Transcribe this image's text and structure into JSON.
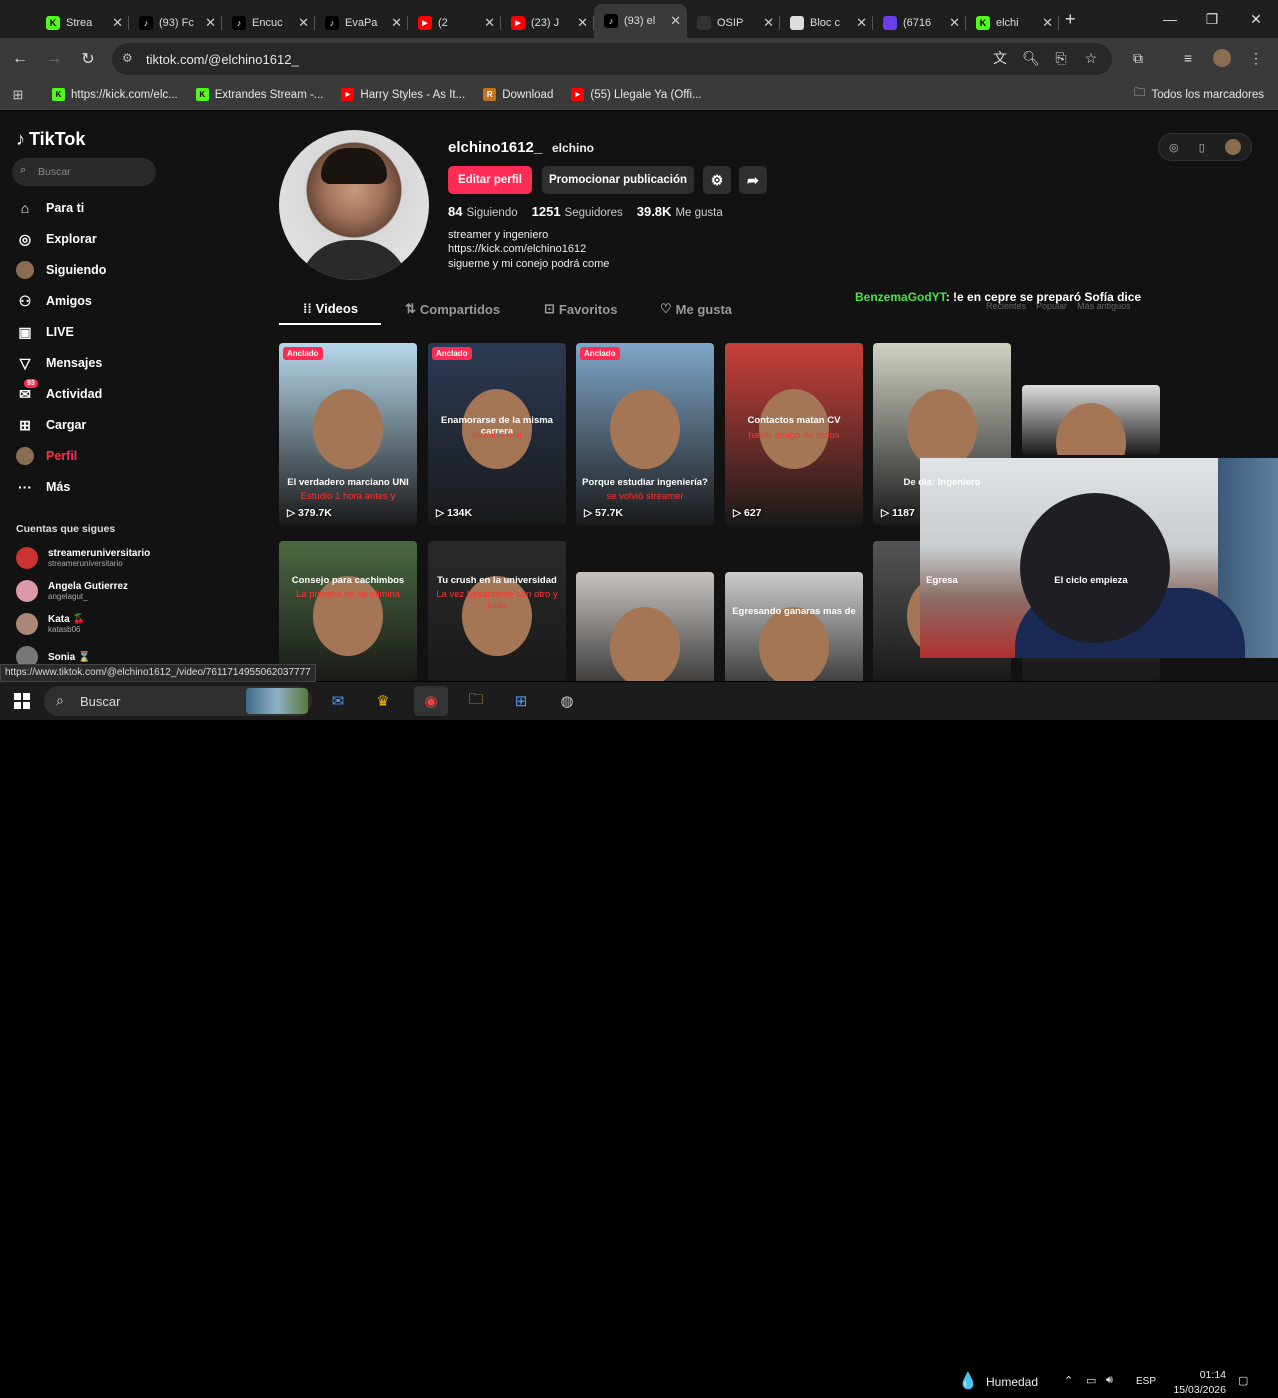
{
  "browser": {
    "tabs": [
      {
        "title": "Strea",
        "icon": "kick-icon",
        "color": "#53fc18"
      },
      {
        "title": "(93) Fc",
        "icon": "tiktok-icon",
        "color": "#000000"
      },
      {
        "title": "Encuc",
        "icon": "tiktok-icon",
        "color": "#000000"
      },
      {
        "title": "EvaPa",
        "icon": "tiktok-icon",
        "color": "#000000"
      },
      {
        "title": "(2",
        "icon": "youtube-icon",
        "color": "#ff0000"
      },
      {
        "title": "(23) J",
        "icon": "youtube-icon",
        "color": "#ff0000"
      },
      {
        "title": "(93) el",
        "icon": "tiktok-icon",
        "color": "#000000",
        "active": true
      },
      {
        "title": "OSIP",
        "icon": "openai-icon",
        "color": "#333333"
      },
      {
        "title": "Bloc c",
        "icon": "notepad-icon",
        "color": "#dddddd"
      },
      {
        "title": "(6716",
        "icon": "mail-icon",
        "color": "#6a3de8"
      },
      {
        "title": "elchi",
        "icon": "kick-icon",
        "color": "#53fc18"
      }
    ],
    "url": "tiktok.com/@elchino1612_",
    "bookmarks": [
      {
        "label": "https://kick.com/elc...",
        "icon": "kick-icon",
        "color": "#53fc18"
      },
      {
        "label": "Extrandes Stream -...",
        "icon": "kick-icon",
        "color": "#53fc18"
      },
      {
        "label": "Harry Styles - As It...",
        "icon": "youtube-icon",
        "color": "#ff0000"
      },
      {
        "label": "Download",
        "icon": "rbx-icon",
        "color": "#c0741b"
      },
      {
        "label": "(55) Llegale Ya (Offi...",
        "icon": "youtube-icon",
        "color": "#ff0000"
      }
    ],
    "all_bookmarks": "Todos los marcadores",
    "status_url": "https://www.tiktok.com/@elchino1612_/video/7611714955062037777"
  },
  "sidebar": {
    "logo": "TikTok",
    "search_placeholder": "Buscar",
    "items": [
      {
        "label": "Para ti",
        "icon": "home-icon"
      },
      {
        "label": "Explorar",
        "icon": "compass-icon"
      },
      {
        "label": "Siguiendo",
        "icon": "following-avatar-icon"
      },
      {
        "label": "Amigos",
        "icon": "friends-icon"
      },
      {
        "label": "LIVE",
        "icon": "live-icon"
      },
      {
        "label": "Mensajes",
        "icon": "send-icon"
      },
      {
        "label": "Actividad",
        "icon": "inbox-icon",
        "badge": "93"
      },
      {
        "label": "Cargar",
        "icon": "upload-icon"
      },
      {
        "label": "Perfil",
        "icon": "profile-avatar-icon",
        "active": true
      },
      {
        "label": "Más",
        "icon": "more-icon"
      }
    ],
    "follows_heading": "Cuentas que sigues",
    "follows": [
      {
        "name": "streameruniversitario",
        "handle": "streameruniversitario"
      },
      {
        "name": "Angela Gutierrez",
        "handle": "angelagut_"
      },
      {
        "name": "Kata 🍒",
        "handle": "katasb06"
      },
      {
        "name": "Sonia ⌛",
        "handle": ""
      }
    ]
  },
  "profile": {
    "username": "elchino1612_",
    "display_name": "elchino",
    "edit_button": "Editar perfil",
    "promote_button": "Promocionar publicación",
    "following_count": "84",
    "following_label": "Siguiendo",
    "followers_count": "1251",
    "followers_label": "Seguidores",
    "likes_count": "39.8K",
    "likes_label": "Me gusta",
    "bio": [
      "streamer y ingeniero",
      "https://kick.com/elchino1612",
      "sigueme y mi conejo podrá come"
    ],
    "tabs": [
      "Videos",
      "Compartidos",
      "Favoritos",
      "Me gusta"
    ],
    "sort": [
      "Recientes",
      "Popular",
      "Más antiguos"
    ],
    "overlay_chat": {
      "user": "BenzemaGodYT",
      "text": ": !e en cepre se preparó Sofía dice"
    }
  },
  "videos": [
    {
      "pinned": "Anclado",
      "views": "379.7K",
      "cap1": "El verdadero marciano UNI",
      "cap2": "Estudio 1 hora antes y"
    },
    {
      "pinned": "Anclado",
      "views": "134K",
      "cap1": "Enamorarse de la misma carrera",
      "cap2": "termina mal"
    },
    {
      "pinned": "Anclado",
      "views": "57.7K",
      "cap1": "Porque estudiar ingeniería?",
      "cap2": "se volvió streamer"
    },
    {
      "pinned": "",
      "views": "627",
      "cap1": "Contactos matan CV",
      "cap2": "haste amigo de todos"
    },
    {
      "pinned": "",
      "views": "1187",
      "cap1": "De día: Ingeniero",
      "cap2": ""
    },
    {
      "pinned": "",
      "views": "",
      "cap1": "",
      "cap2": ""
    },
    {
      "pinned": "",
      "views": "",
      "cap1": "Consejo para cachimbos",
      "cap2": "La primera no se elimina"
    },
    {
      "pinned": "",
      "views": "",
      "cap1": "Tu crush en la universidad",
      "cap2": "La vez besándose con otro y jalas"
    },
    {
      "pinned": "",
      "views": "",
      "cap1": "",
      "cap2": ""
    },
    {
      "pinned": "",
      "views": "",
      "cap1": "Egresando ganaras mas de",
      "cap2": ""
    },
    {
      "pinned": "",
      "views": "",
      "cap1": "Egresa",
      "cap2": ""
    },
    {
      "pinned": "",
      "views": "",
      "cap1": "El ciclo empieza",
      "cap2": ""
    }
  ],
  "taskbar": {
    "search": "Buscar",
    "weather": "Humedad",
    "lang": "ESP",
    "time": "01:14",
    "date": "15/03/2026"
  }
}
